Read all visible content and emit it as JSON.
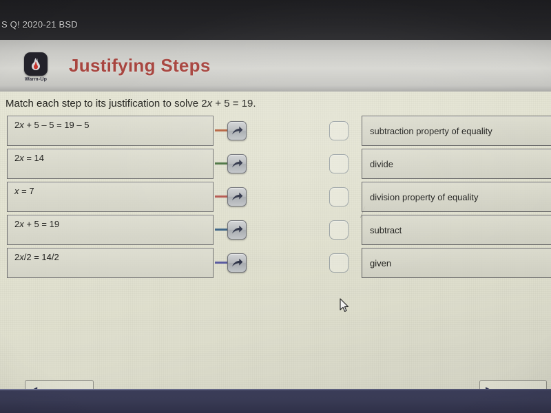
{
  "browser": {
    "tab_title": "S Q! 2020-21 BSD"
  },
  "header": {
    "logo_caption": "Warm-Up",
    "logo_icon": "flame-icon",
    "title": "Justifying Steps"
  },
  "worksheet": {
    "prompt_before": "Match each step to its justification to solve 2",
    "prompt_var": "x",
    "prompt_after": " + 5 = 19.",
    "arrow_icon": "arrow-right-icon",
    "steps": [
      {
        "before": "2",
        "var": "x",
        "after": " + 5 – 5 = 19 – 5",
        "connector_color": "#b5623f"
      },
      {
        "before": "2",
        "var": "x",
        "after": " = 14",
        "connector_color": "#4a7340"
      },
      {
        "before": "",
        "var": "x",
        "after": " = 7",
        "connector_color": "#b4564e"
      },
      {
        "before": "2",
        "var": "x",
        "after": " + 5 = 19",
        "connector_color": "#3c6384"
      },
      {
        "before": "2",
        "var": "x",
        "after": "/2 = 14/2",
        "connector_color": "#5a5ba0"
      }
    ],
    "justifications": [
      {
        "label": "subtraction property of equality",
        "checkbox": "unchecked"
      },
      {
        "label": "divide",
        "checkbox": "unchecked"
      },
      {
        "label": "division property of equality",
        "checkbox": "unchecked"
      },
      {
        "label": "subtract",
        "checkbox": "unchecked"
      },
      {
        "label": "given",
        "checkbox": "unchecked"
      }
    ]
  },
  "footer": {
    "left_button_glyph": "◀",
    "left_button_label": "",
    "right_button_glyph": "▶",
    "right_button_label": ""
  },
  "colors": {
    "title": "#a8453f",
    "paper": "#e3e3d2",
    "bottom_band": "#393b55"
  }
}
